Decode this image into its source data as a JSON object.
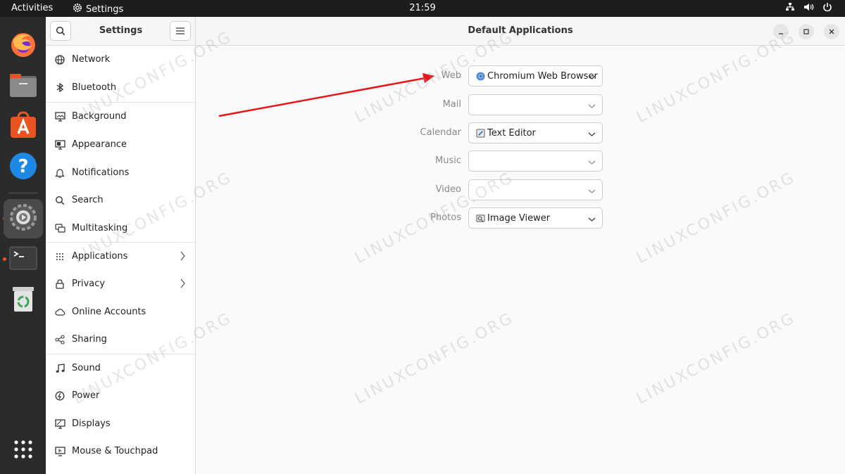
{
  "topbar": {
    "activities": "Activities",
    "app_name": "Settings",
    "clock": "21:59",
    "status_icons": [
      "network-icon",
      "volume-icon",
      "power-icon"
    ]
  },
  "dock": {
    "apps": [
      {
        "name": "firefox-icon"
      },
      {
        "name": "files-icon"
      },
      {
        "name": "app-center-icon"
      },
      {
        "name": "help-icon"
      },
      {
        "name": "settings-icon"
      },
      {
        "name": "terminal-icon"
      },
      {
        "name": "trash-icon"
      },
      {
        "name": "show-apps-icon"
      }
    ]
  },
  "sidebar": {
    "title": "Settings",
    "items": [
      {
        "label": "Network",
        "icon": "network-icon"
      },
      {
        "label": "Bluetooth",
        "icon": "bluetooth-icon"
      },
      {
        "label": "Background",
        "icon": "background-icon"
      },
      {
        "label": "Appearance",
        "icon": "appearance-icon"
      },
      {
        "label": "Notifications",
        "icon": "bell-icon"
      },
      {
        "label": "Search",
        "icon": "search-icon"
      },
      {
        "label": "Multitasking",
        "icon": "multitasking-icon"
      },
      {
        "label": "Applications",
        "icon": "grid-icon"
      },
      {
        "label": "Privacy",
        "icon": "lock-icon"
      },
      {
        "label": "Online Accounts",
        "icon": "cloud-icon"
      },
      {
        "label": "Sharing",
        "icon": "share-icon"
      },
      {
        "label": "Sound",
        "icon": "music-note-icon"
      },
      {
        "label": "Power",
        "icon": "power-icon"
      },
      {
        "label": "Displays",
        "icon": "display-icon"
      },
      {
        "label": "Mouse & Touchpad",
        "icon": "mouse-icon"
      }
    ]
  },
  "main": {
    "title": "Default Applications",
    "rows": [
      {
        "label": "Web",
        "value": "Chromium Web Browser",
        "icon": "chromium-icon"
      },
      {
        "label": "Mail",
        "value": "",
        "icon": ""
      },
      {
        "label": "Calendar",
        "value": "Text Editor",
        "icon": "text-editor-icon"
      },
      {
        "label": "Music",
        "value": "",
        "icon": ""
      },
      {
        "label": "Video",
        "value": "",
        "icon": ""
      },
      {
        "label": "Photos",
        "value": "Image Viewer",
        "icon": "image-viewer-icon"
      }
    ]
  },
  "watermark": "LINUXCONFIG.ORG",
  "colors": {
    "accent": "#e95420",
    "annotation_arrow": "#e8161b"
  }
}
